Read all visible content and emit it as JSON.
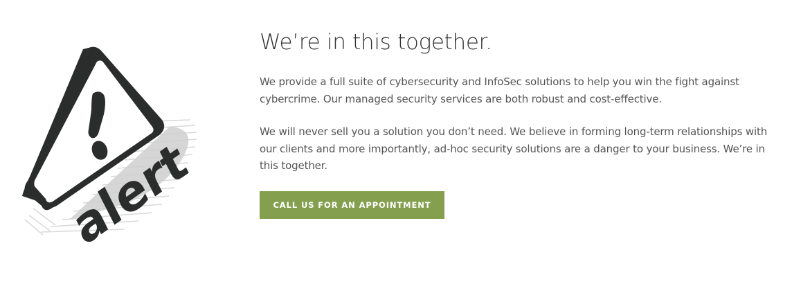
{
  "illustration": {
    "word": "alert",
    "icon": "warning-triangle-icon",
    "colors": {
      "outline": "#2a2d2b",
      "fill": "#ffffff",
      "shadow": "#cfcfcf",
      "hatch": "#d9d9d9"
    }
  },
  "content": {
    "title": "We’re in this together.",
    "paragraph1": "We provide a full suite of cybersecurity and InfoSec solutions to help you win the fight against cybercrime. Our managed security services are both robust and cost-effective.",
    "paragraph2": "We will never sell you a solution you don’t need. We believe in forming long-term relationships with our clients and more importantly, ad-hoc security solutions are a danger to your business. We’re in this together.",
    "cta_label": "CALL US FOR AN APPOINTMENT"
  },
  "colors": {
    "accent": "#84a04f",
    "heading": "#333333",
    "body_text": "#555555"
  }
}
